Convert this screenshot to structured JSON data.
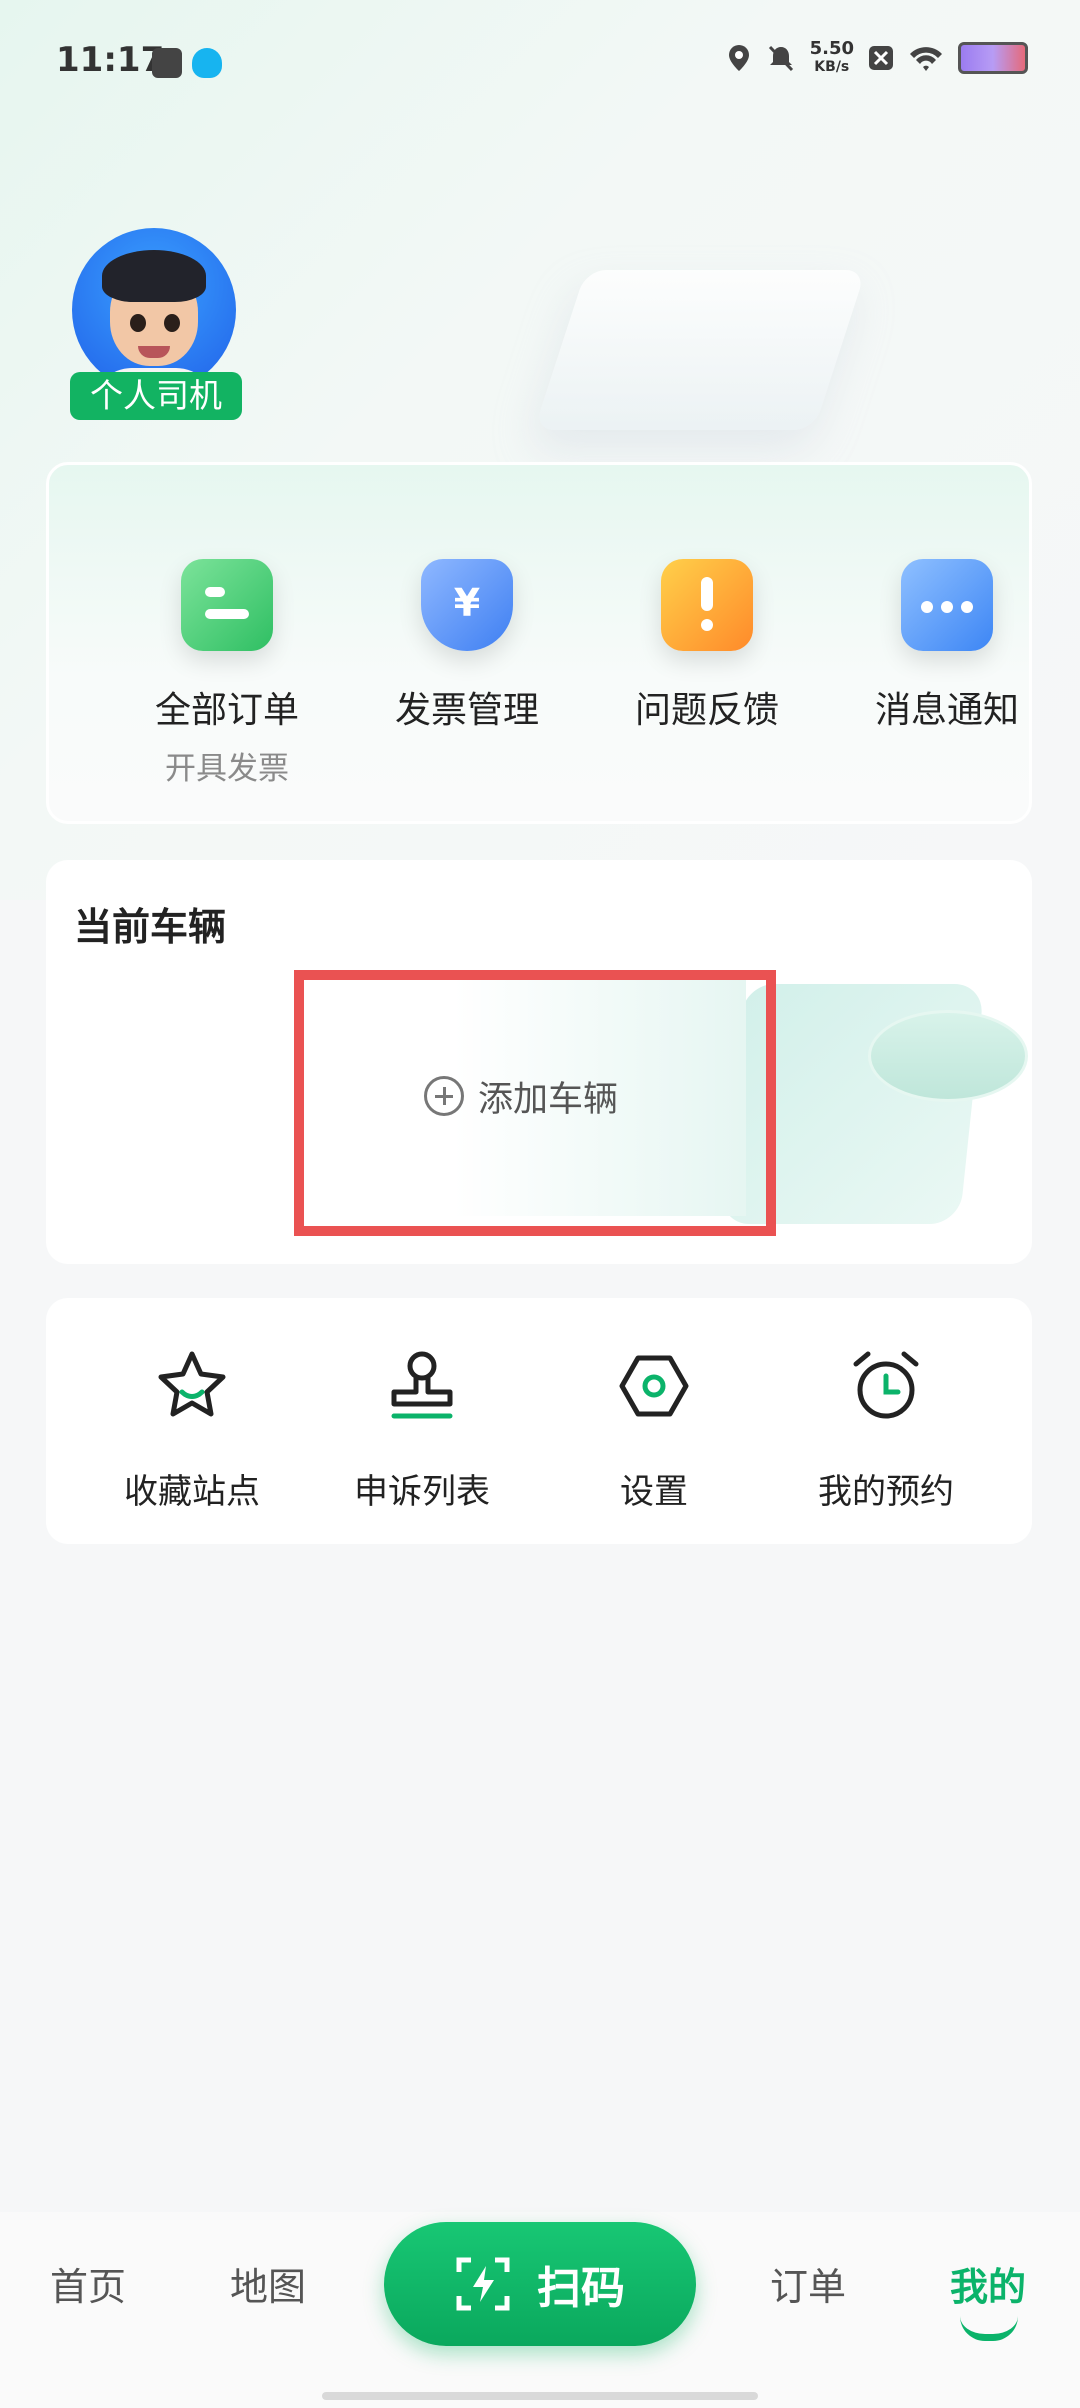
{
  "status_bar": {
    "time": "11:17",
    "speed_value": "5.50",
    "speed_unit": "KB/s"
  },
  "profile": {
    "role": "个人司机"
  },
  "services": [
    {
      "label": "全部订单",
      "sub": "开具发票",
      "icon": "orders-icon",
      "color": "#36c96e"
    },
    {
      "label": "发票管理",
      "sub": "",
      "icon": "invoice-icon",
      "color": "#4a8cf5"
    },
    {
      "label": "问题反馈",
      "sub": "",
      "icon": "feedback-icon",
      "color": "#ff9d2e"
    },
    {
      "label": "消息通知",
      "sub": "",
      "icon": "message-icon",
      "color": "#4d8ff6"
    }
  ],
  "vehicle": {
    "title": "当前车辆",
    "add_label": "添加车辆"
  },
  "tools": [
    {
      "label": "收藏站点",
      "icon": "star-icon"
    },
    {
      "label": "申诉列表",
      "icon": "stamp-icon"
    },
    {
      "label": "设置",
      "icon": "settings-icon"
    },
    {
      "label": "我的预约",
      "icon": "alarm-clock-icon"
    }
  ],
  "tabbar": {
    "home": "首页",
    "map": "地图",
    "scan": "扫码",
    "orders": "订单",
    "mine": "我的"
  },
  "colors": {
    "brand": "#0bb36a",
    "highlight": "#ea5252"
  }
}
